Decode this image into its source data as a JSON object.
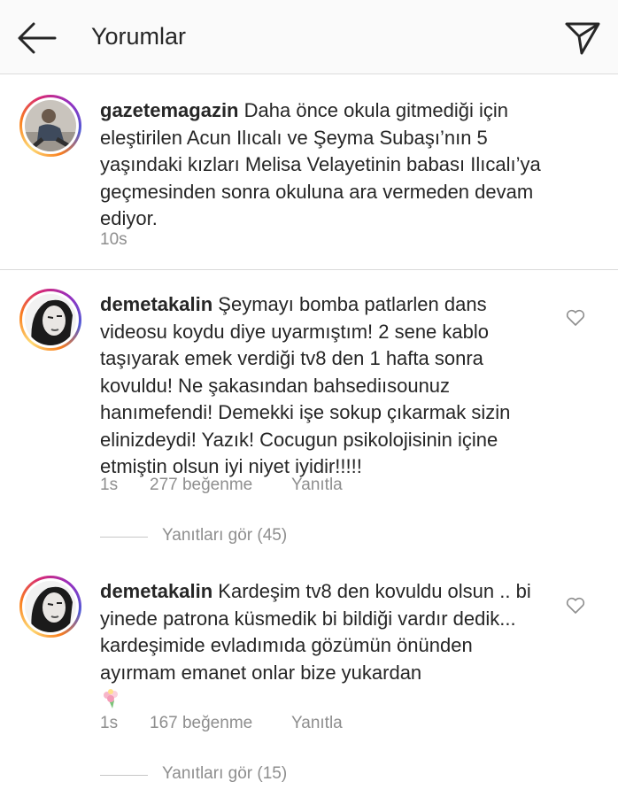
{
  "header": {
    "title": "Yorumlar",
    "back_icon": "arrow-left-icon",
    "send_icon": "paper-plane-icon"
  },
  "caption": {
    "username": "gazetemagazin",
    "text": "Daha önce okula gitmediği için eleştirilen Acun Ilıcalı ve Şeyma Subaşı’nın 5 yaşındaki kızları Melisa Velayetinin babası Ilıcalı’ya geçmesinden sonra okuluna ara vermeden devam ediyor.",
    "time": "10s"
  },
  "comments": [
    {
      "username": "demetakalin",
      "text": "Şeymayı bomba patlarlen dans videosu koydu diye uyarmıştım! 2 sene kablo taşıyarak emek verdiği tv8 den 1 hafta sonra kovuldu! Ne şakasından bahsediısounuz hanımefendi! Demekki işe sokup çıkarmak sizin elinizdeydi! Yazık! Cocugun psikolojisinin içine etmiştin olsun iyi niyet iyidir!!!!!",
      "time": "1s",
      "likes": "277 beğenme",
      "reply_label": "Yanıtla",
      "view_replies": "Yanıtları gör (45)"
    },
    {
      "username": "demetakalin",
      "text": "Kardeşim tv8 den kovuldu olsun .. bi yinede patrona küsmedik bi bildiği vardır dedik... kardeşimide evladımıda gözümün önünden ayırmam emanet onlar bize yukardan",
      "emoji_icon": "bouquet-emoji-icon",
      "time": "1s",
      "likes": "167 beğenme",
      "reply_label": "Yanıtla",
      "view_replies": "Yanıtları gör (15)"
    }
  ],
  "colors": {
    "text": "#262626",
    "secondary": "#8e8e8e",
    "divider": "#dbdbdb",
    "header_bg": "#fafafa"
  }
}
